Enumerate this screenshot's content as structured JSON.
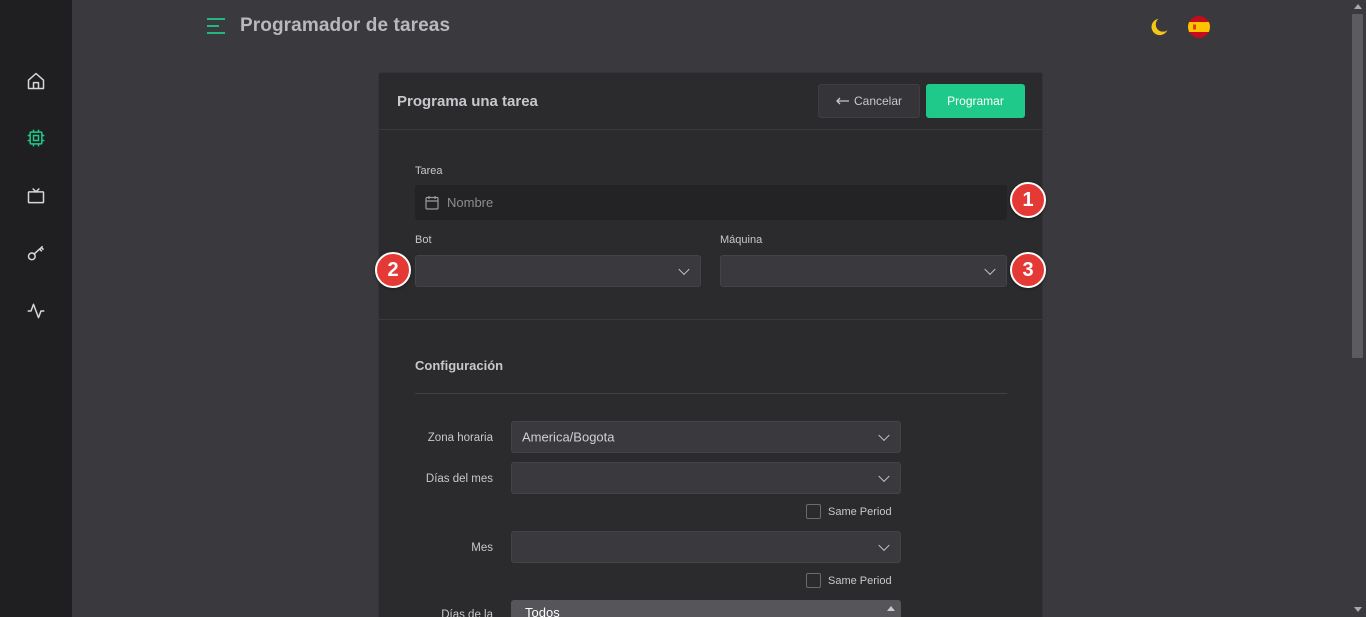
{
  "header": {
    "title": "Programador de tareas",
    "menu_icon": "menu-icon",
    "theme_icon": "moon-icon",
    "language_icon": "spain-flag-icon"
  },
  "sidebar": {
    "items": [
      {
        "icon": "home-icon",
        "active": false
      },
      {
        "icon": "cpu-icon",
        "active": true
      },
      {
        "icon": "tv-icon",
        "active": false
      },
      {
        "icon": "key-icon",
        "active": false
      },
      {
        "icon": "activity-icon",
        "active": false
      }
    ]
  },
  "card": {
    "title": "Programa una tarea",
    "cancel_label": "Cancelar",
    "program_label": "Programar"
  },
  "form": {
    "task_label": "Tarea",
    "task_placeholder": "Nombre",
    "bot_label": "Bot",
    "machine_label": "Máquina",
    "bot_value": "",
    "machine_value": ""
  },
  "config": {
    "title": "Configuración",
    "timezone_label": "Zona horaria",
    "timezone_value": "America/Bogota",
    "days_month_label": "Días del mes",
    "days_month_value": "",
    "same_period_1": "Same Period",
    "month_label": "Mes",
    "month_value": "",
    "same_period_2": "Same Period",
    "days_week_label": "Días de la",
    "days_week_value": "Todos"
  },
  "badges": [
    "1",
    "2",
    "3"
  ],
  "colors": {
    "accent": "#1fc98a",
    "badge": "#e53935",
    "sidebar_bg": "#1f1f22",
    "page_bg": "#3a3a3e"
  }
}
